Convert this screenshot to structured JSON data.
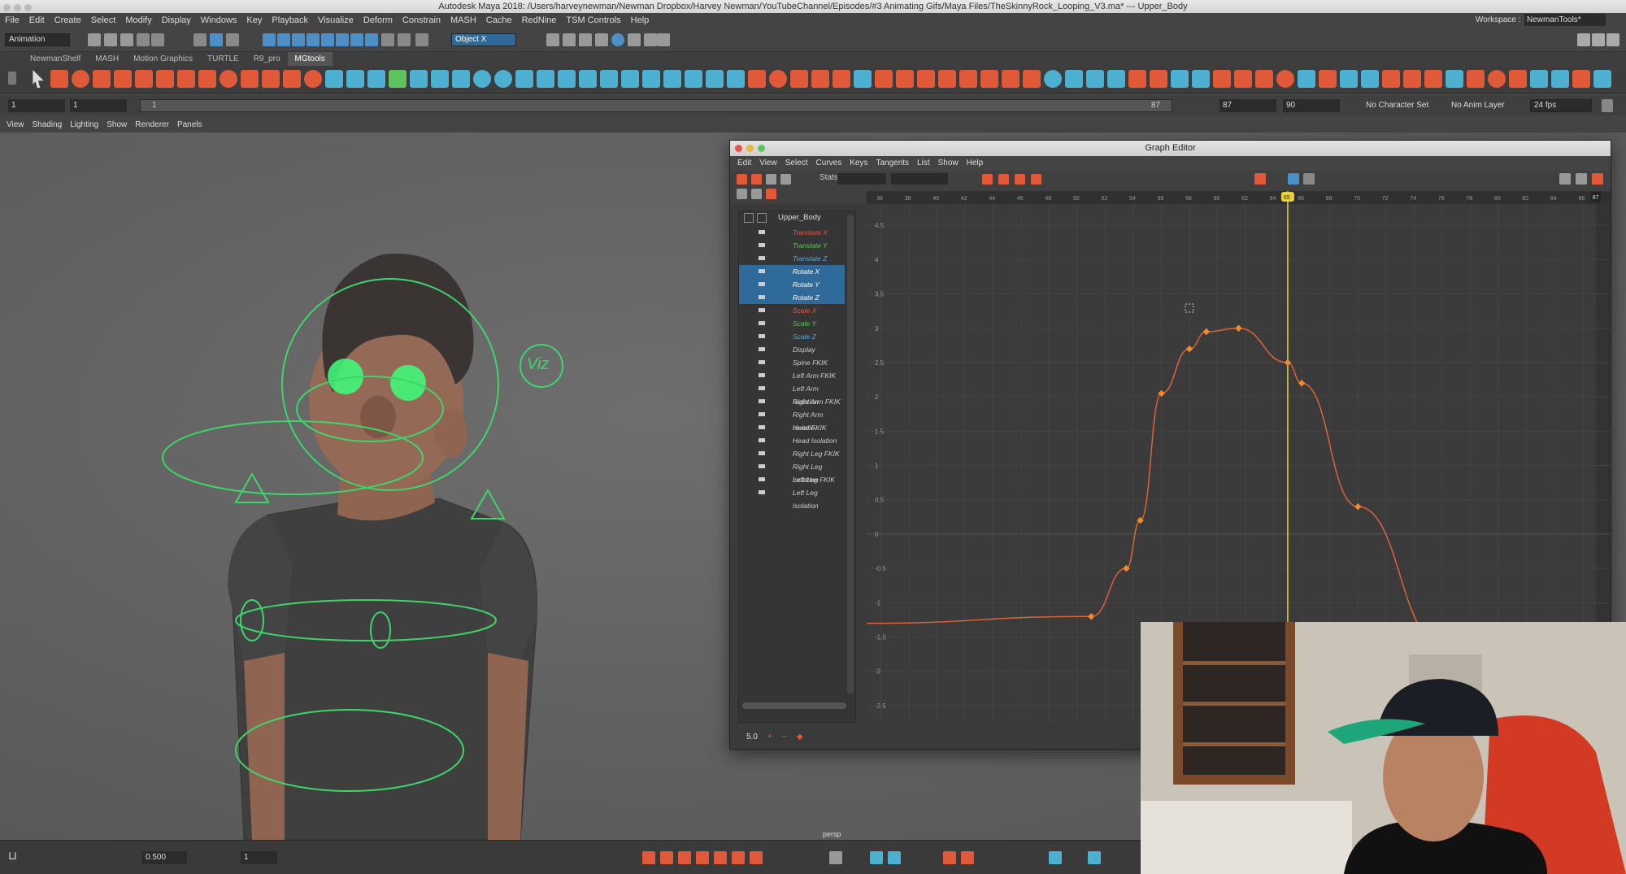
{
  "window": {
    "title": "Autodesk Maya 2018: /Users/harveynewman/Newman Dropbox/Harvey Newman/YouTubeChannel/Episodes/#3 Animating Gifs/Maya Files/TheSkinnyRock_Looping_V3.ma*  ---  Upper_Body"
  },
  "menubar": {
    "items": [
      "File",
      "Edit",
      "Create",
      "Select",
      "Modify",
      "Display",
      "Windows",
      "Key",
      "Playback",
      "Visualize",
      "Deform",
      "Constrain",
      "MASH",
      "Cache",
      "RedNine",
      "TSM Controls",
      "Help"
    ],
    "workspace_label": "Workspace :",
    "workspace_value": "NewmanTools*"
  },
  "statusline": {
    "menuset": "Animation",
    "object_field": "Object X"
  },
  "shelf": {
    "tabs": [
      "NewmanShelf",
      "MASH",
      "Motion Graphics",
      "TURTLE",
      "R9_pro",
      "MGtools"
    ],
    "active_tab": "MGtools"
  },
  "timebar": {
    "start": "1",
    "range_start": "1",
    "slider_start": "1",
    "slider_end": "87",
    "end_field": "87",
    "anim_end": "90",
    "character_set": "No Character Set",
    "anim_layer": "No Anim Layer",
    "fps": "24 fps"
  },
  "panel_menu": {
    "items": [
      "View",
      "Shading",
      "Lighting",
      "Show",
      "Renderer",
      "Panels"
    ]
  },
  "viewport": {
    "camera_label": "persp",
    "viz_label": "Viz"
  },
  "graph_editor": {
    "title": "Graph Editor",
    "menu": [
      "Edit",
      "View",
      "Select",
      "Curves",
      "Keys",
      "Tangents",
      "List",
      "Show",
      "Help"
    ],
    "stats_label": "Stats",
    "outliner_root": "Upper_Body",
    "channels": [
      {
        "label": "Translate X",
        "color": "#e0584a",
        "selected": false
      },
      {
        "label": "Translate Y",
        "color": "#5fc25f",
        "selected": false
      },
      {
        "label": "Translate Z",
        "color": "#5aa7e0",
        "selected": false
      },
      {
        "label": "Rotate X",
        "color": "#ffffff",
        "selected": true
      },
      {
        "label": "Rotate Y",
        "color": "#ffffff",
        "selected": true
      },
      {
        "label": "Rotate Z",
        "color": "#ffffff",
        "selected": true
      },
      {
        "label": "Scale X",
        "color": "#e0584a",
        "selected": false
      },
      {
        "label": "Scale Y",
        "color": "#5fc25f",
        "selected": false
      },
      {
        "label": "Scale Z",
        "color": "#5aa7e0",
        "selected": false
      },
      {
        "label": "Display",
        "color": "#cccccc",
        "selected": false
      },
      {
        "label": "Spine FKIK",
        "color": "#cccccc",
        "selected": false
      },
      {
        "label": "Left Arm FKIK",
        "color": "#cccccc",
        "selected": false
      },
      {
        "label": "Left Arm Isolation",
        "color": "#cccccc",
        "selected": false
      },
      {
        "label": "Right Arm FKIK",
        "color": "#cccccc",
        "selected": false
      },
      {
        "label": "Right Arm Isolatio...",
        "color": "#cccccc",
        "selected": false
      },
      {
        "label": "Head FKIK",
        "color": "#cccccc",
        "selected": false
      },
      {
        "label": "Head Isolation",
        "color": "#cccccc",
        "selected": false
      },
      {
        "label": "Right Leg FKIK",
        "color": "#cccccc",
        "selected": false
      },
      {
        "label": "Right Leg Isolation",
        "color": "#cccccc",
        "selected": false
      },
      {
        "label": "Left Leg FKIK",
        "color": "#cccccc",
        "selected": false
      },
      {
        "label": "Left Leg Isolation",
        "color": "#cccccc",
        "selected": false
      }
    ],
    "footer_value": "5.0",
    "current_frame": "65",
    "end_marker": "87",
    "frame_ticks": [
      "36",
      "38",
      "40",
      "42",
      "44",
      "46",
      "48",
      "50",
      "52",
      "54",
      "56",
      "58",
      "60",
      "62",
      "64",
      "66",
      "68",
      "70",
      "72",
      "74",
      "76",
      "78",
      "80",
      "82",
      "84",
      "86"
    ],
    "value_ticks": [
      "4.5",
      "4",
      "3.5",
      "3",
      "2.5",
      "2",
      "1.5",
      "1",
      "0.5",
      "0",
      "-0.5",
      "-1",
      "-1.5",
      "-2",
      "-2.5"
    ]
  },
  "bottombar": {
    "value_a": "0.500",
    "value_b": "1"
  }
}
